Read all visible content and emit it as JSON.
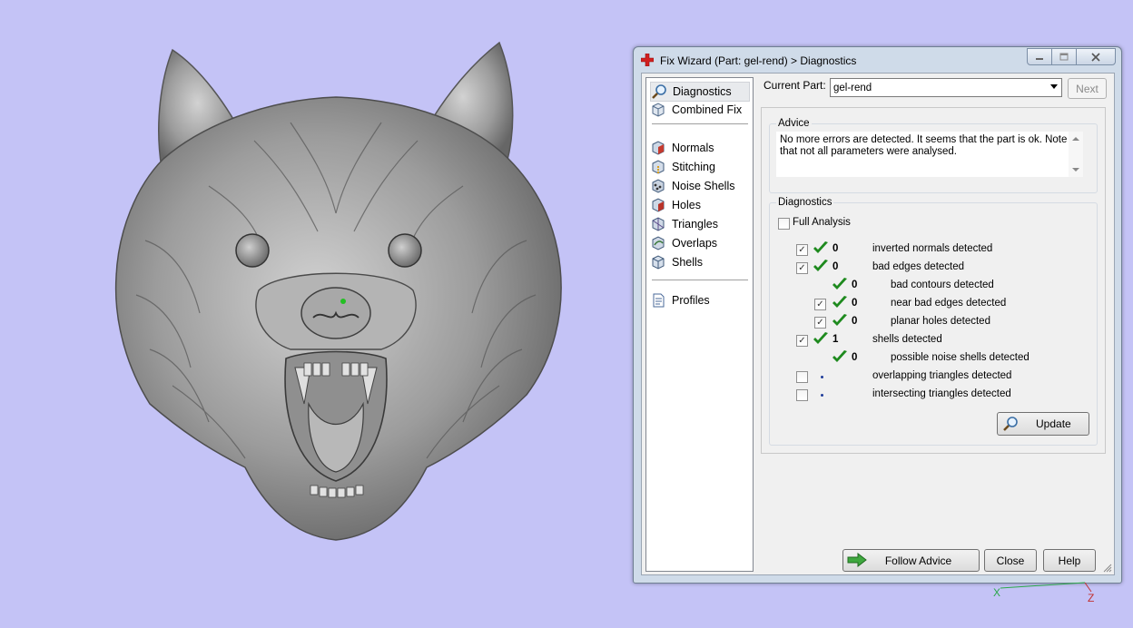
{
  "window": {
    "title": "Fix Wizard (Part: gel-rend) > Diagnostics",
    "title_icon": "red-cross-icon",
    "controls": [
      "minimize-icon",
      "maximize-icon",
      "close-icon"
    ]
  },
  "sidebar": {
    "items": [
      {
        "label": "Diagnostics",
        "icon": "magnifier-icon",
        "selected": true
      },
      {
        "label": "Combined Fix",
        "icon": "cube-icon"
      },
      {
        "label": "Normals",
        "icon": "normals-cube-icon"
      },
      {
        "label": "Stitching",
        "icon": "stitching-cube-icon"
      },
      {
        "label": "Noise Shells",
        "icon": "noise-shells-icon"
      },
      {
        "label": "Holes",
        "icon": "holes-cube-icon"
      },
      {
        "label": "Triangles",
        "icon": "triangles-cube-icon"
      },
      {
        "label": "Overlaps",
        "icon": "overlaps-cube-icon"
      },
      {
        "label": "Shells",
        "icon": "shells-cube-icon"
      },
      {
        "label": "Profiles",
        "icon": "document-icon"
      }
    ]
  },
  "current_part": {
    "label": "Current Part:",
    "value": "gel-rend"
  },
  "next_label": "Next",
  "advice": {
    "title": "Advice",
    "text": "No more errors are detected. It seems that the part is ok. Note that not all parameters were analysed."
  },
  "diagnostics": {
    "title": "Diagnostics",
    "full_analysis": {
      "label": "Full Analysis",
      "checked": false
    },
    "rows": [
      {
        "checked": true,
        "status": "ok",
        "count": "0",
        "label": "inverted normals detected"
      },
      {
        "checked": true,
        "status": "ok",
        "count": "0",
        "label": "bad edges detected"
      },
      {
        "checked": null,
        "status": "ok",
        "count": "0",
        "label": "bad contours detected"
      },
      {
        "checked": true,
        "status": "ok",
        "count": "0",
        "label": "near bad edges detected"
      },
      {
        "checked": true,
        "status": "ok",
        "count": "0",
        "label": "planar holes detected"
      },
      {
        "checked": true,
        "status": "ok",
        "count": "1",
        "label": "shells detected"
      },
      {
        "checked": null,
        "status": "ok",
        "count": "0",
        "label": "possible noise shells detected"
      },
      {
        "checked": false,
        "status": "none",
        "count": "",
        "label": "overlapping triangles detected"
      },
      {
        "checked": false,
        "status": "none",
        "count": "",
        "label": "intersecting triangles detected"
      }
    ],
    "update_label": "Update"
  },
  "buttons": {
    "follow_advice": "Follow Advice",
    "close": "Close",
    "help": "Help"
  },
  "axis": {
    "x_label": "X",
    "z_label": "Z"
  },
  "colors": {
    "background": "#c4c3f6",
    "tick": "#1e8a1e",
    "model": "#9a9a9a"
  }
}
